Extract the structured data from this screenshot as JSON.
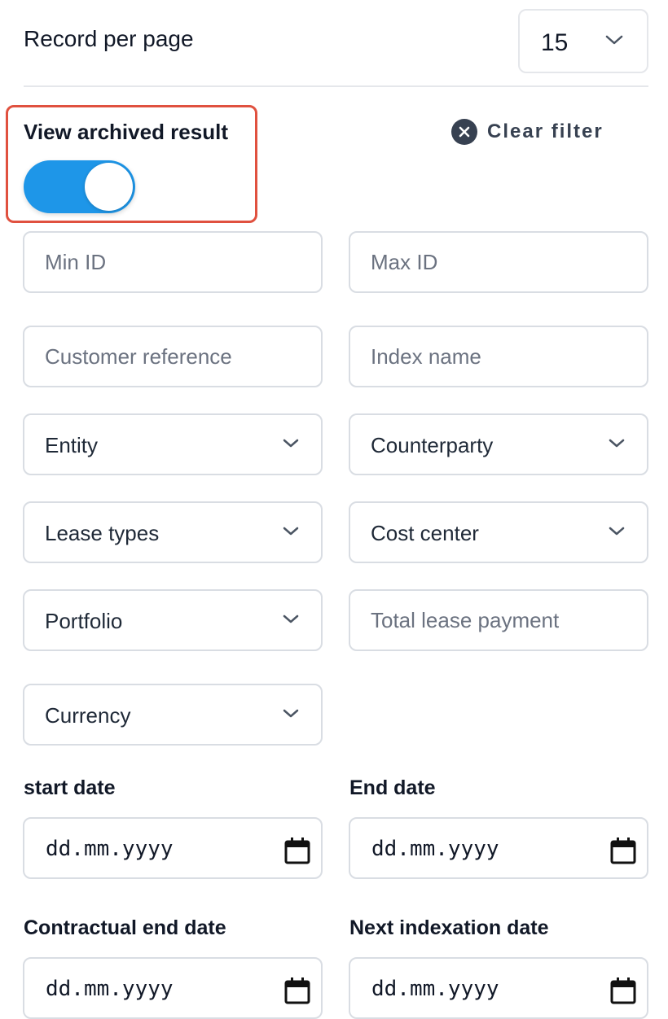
{
  "header": {
    "records_label": "Record per page",
    "records_value": "15"
  },
  "archived": {
    "label": "View archived result",
    "enabled": true,
    "toggle_color": "#1e96e8",
    "highlight_color": "#e0513f"
  },
  "clear_filter": {
    "label": "Clear filter"
  },
  "fields": {
    "min_id": {
      "placeholder": "Min ID",
      "value": ""
    },
    "max_id": {
      "placeholder": "Max ID",
      "value": ""
    },
    "customer_reference": {
      "placeholder": "Customer reference",
      "value": ""
    },
    "index_name": {
      "placeholder": "Index name",
      "value": ""
    },
    "entity": {
      "label": "Entity"
    },
    "counterparty": {
      "label": "Counterparty"
    },
    "lease_types": {
      "label": "Lease types"
    },
    "cost_center": {
      "label": "Cost center"
    },
    "portfolio": {
      "label": "Portfolio"
    },
    "total_lease_payment": {
      "placeholder": "Total lease payment",
      "value": ""
    },
    "currency": {
      "label": "Currency"
    }
  },
  "dates": {
    "start": {
      "label": "start date",
      "value": "dd.mm.yyyy"
    },
    "end": {
      "label": "End date",
      "value": "dd.mm.yyyy"
    },
    "contractual_end": {
      "label": "Contractual end date",
      "value": "dd.mm.yyyy"
    },
    "next_indexation": {
      "label": "Next indexation date",
      "value": "dd.mm.yyyy"
    }
  },
  "icons": {
    "chevron": "chevron-down-icon",
    "calendar": "calendar-icon",
    "clear": "close-circle-icon"
  }
}
